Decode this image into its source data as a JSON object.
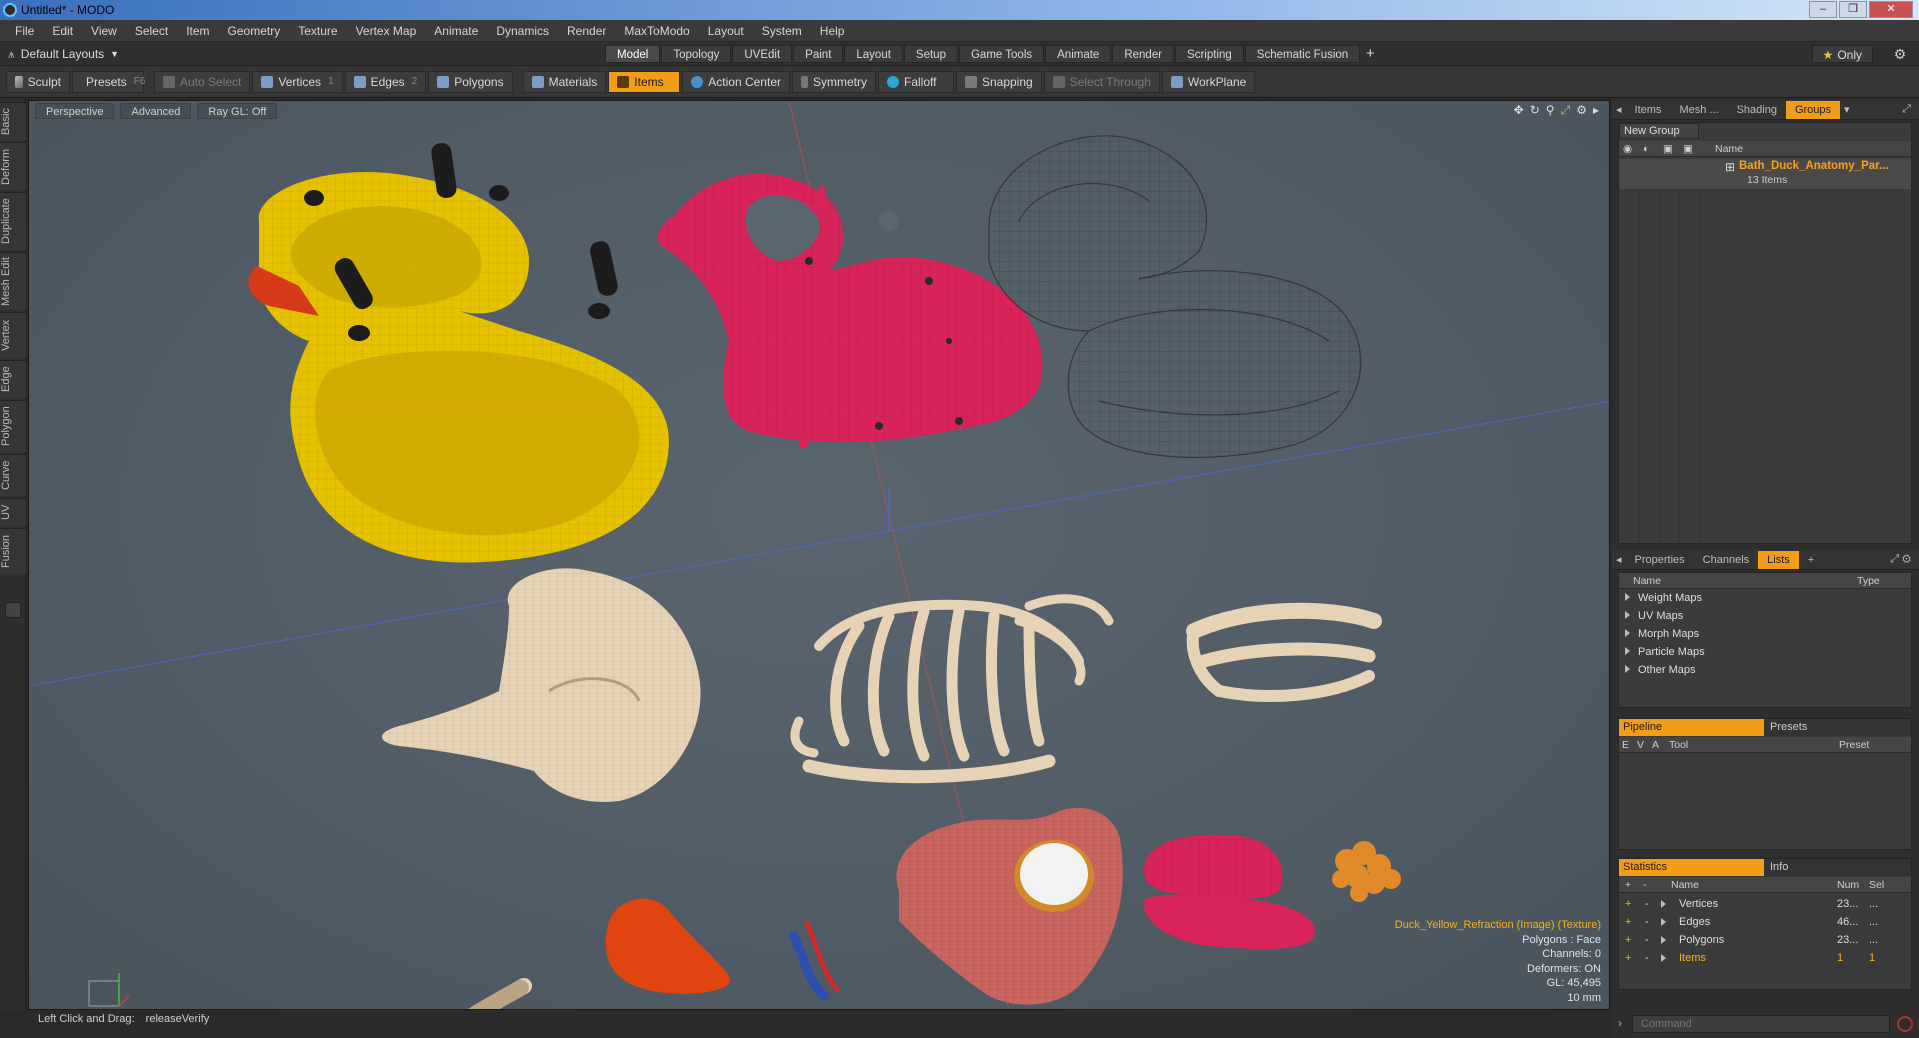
{
  "window": {
    "title": "Untitled* - MODO",
    "buttons": [
      "–",
      "❐",
      "✕"
    ]
  },
  "menu": [
    "File",
    "Edit",
    "View",
    "Select",
    "Item",
    "Geometry",
    "Texture",
    "Vertex Map",
    "Animate",
    "Dynamics",
    "Render",
    "MaxToModo",
    "Layout",
    "System",
    "Help"
  ],
  "layout_bar": {
    "layouts_label": "Default Layouts",
    "tabs": [
      "Model",
      "Topology",
      "UVEdit",
      "Paint",
      "Layout",
      "Setup",
      "Game Tools",
      "Animate",
      "Render",
      "Scripting",
      "Schematic Fusion"
    ],
    "active_tab": "Model",
    "plus": "+",
    "only_label": "Only"
  },
  "toolbar": {
    "sculpt": "Sculpt",
    "presets": "Presets",
    "presets_key": "F6",
    "auto_select": "Auto Select",
    "vertices": "Vertices",
    "vertices_key": "1",
    "edges": "Edges",
    "edges_key": "2",
    "polygons": "Polygons",
    "materials": "Materials",
    "items": "Items",
    "action_center": "Action Center",
    "symmetry": "Symmetry",
    "falloff": "Falloff",
    "snapping": "Snapping",
    "select_through": "Select Through",
    "workplane": "WorkPlane"
  },
  "left_tabs": [
    "Basic",
    "Deform",
    "Duplicate",
    "Mesh Edit",
    "Vertex",
    "Edge",
    "Polygon",
    "Curve",
    "UV",
    "Fusion"
  ],
  "viewport": {
    "header": [
      "Perspective",
      "Advanced",
      "Ray GL: Off"
    ],
    "info": {
      "texture": "Duck_Yellow_Refraction (Image) (Texture)",
      "polygons": "Polygons : Face",
      "channels": "Channels: 0",
      "deformers": "Deformers: ON",
      "gl": "GL: 45,495",
      "units": "10 mm"
    }
  },
  "status_line": {
    "label": "Left Click and Drag:",
    "value": "releaseVerify"
  },
  "items_panel": {
    "tabs": [
      "Items",
      "Mesh ...",
      "Shading",
      "Groups"
    ],
    "active_tab": "Groups",
    "new_group": "New Group",
    "col_name": "Name",
    "group_name": "Bath_Duck_Anatomy_Par...",
    "group_count": "13 Items"
  },
  "props_panel": {
    "tabs": [
      "Properties",
      "Channels",
      "Lists"
    ],
    "active_tab": "Lists",
    "col_name": "Name",
    "col_type": "Type",
    "rows": [
      "Weight Maps",
      "UV Maps",
      "Morph Maps",
      "Particle Maps",
      "Other Maps"
    ]
  },
  "pipeline_panel": {
    "tabs": [
      "Pipeline",
      "Presets"
    ],
    "cols": [
      "E",
      "V",
      "A",
      "Tool",
      "Preset"
    ]
  },
  "stats_panel": {
    "tabs": [
      "Statistics",
      "Info"
    ],
    "cols": [
      "+",
      "-",
      "Name",
      "Num",
      "Sel"
    ],
    "rows": [
      {
        "name": "Vertices",
        "num": "23...",
        "sel": "..."
      },
      {
        "name": "Edges",
        "num": "46...",
        "sel": "..."
      },
      {
        "name": "Polygons",
        "num": "23...",
        "sel": "..."
      },
      {
        "name": "Items",
        "num": "1",
        "sel": "1"
      }
    ]
  },
  "command": {
    "placeholder": "Command"
  },
  "colors": {
    "accent": "#f29d18",
    "duck_yellow": "#e5c100",
    "duck_red": "#d8245a",
    "bone": "#e6d3b5",
    "organ_pink": "#c8655e",
    "beak_orange": "#e0450f"
  }
}
